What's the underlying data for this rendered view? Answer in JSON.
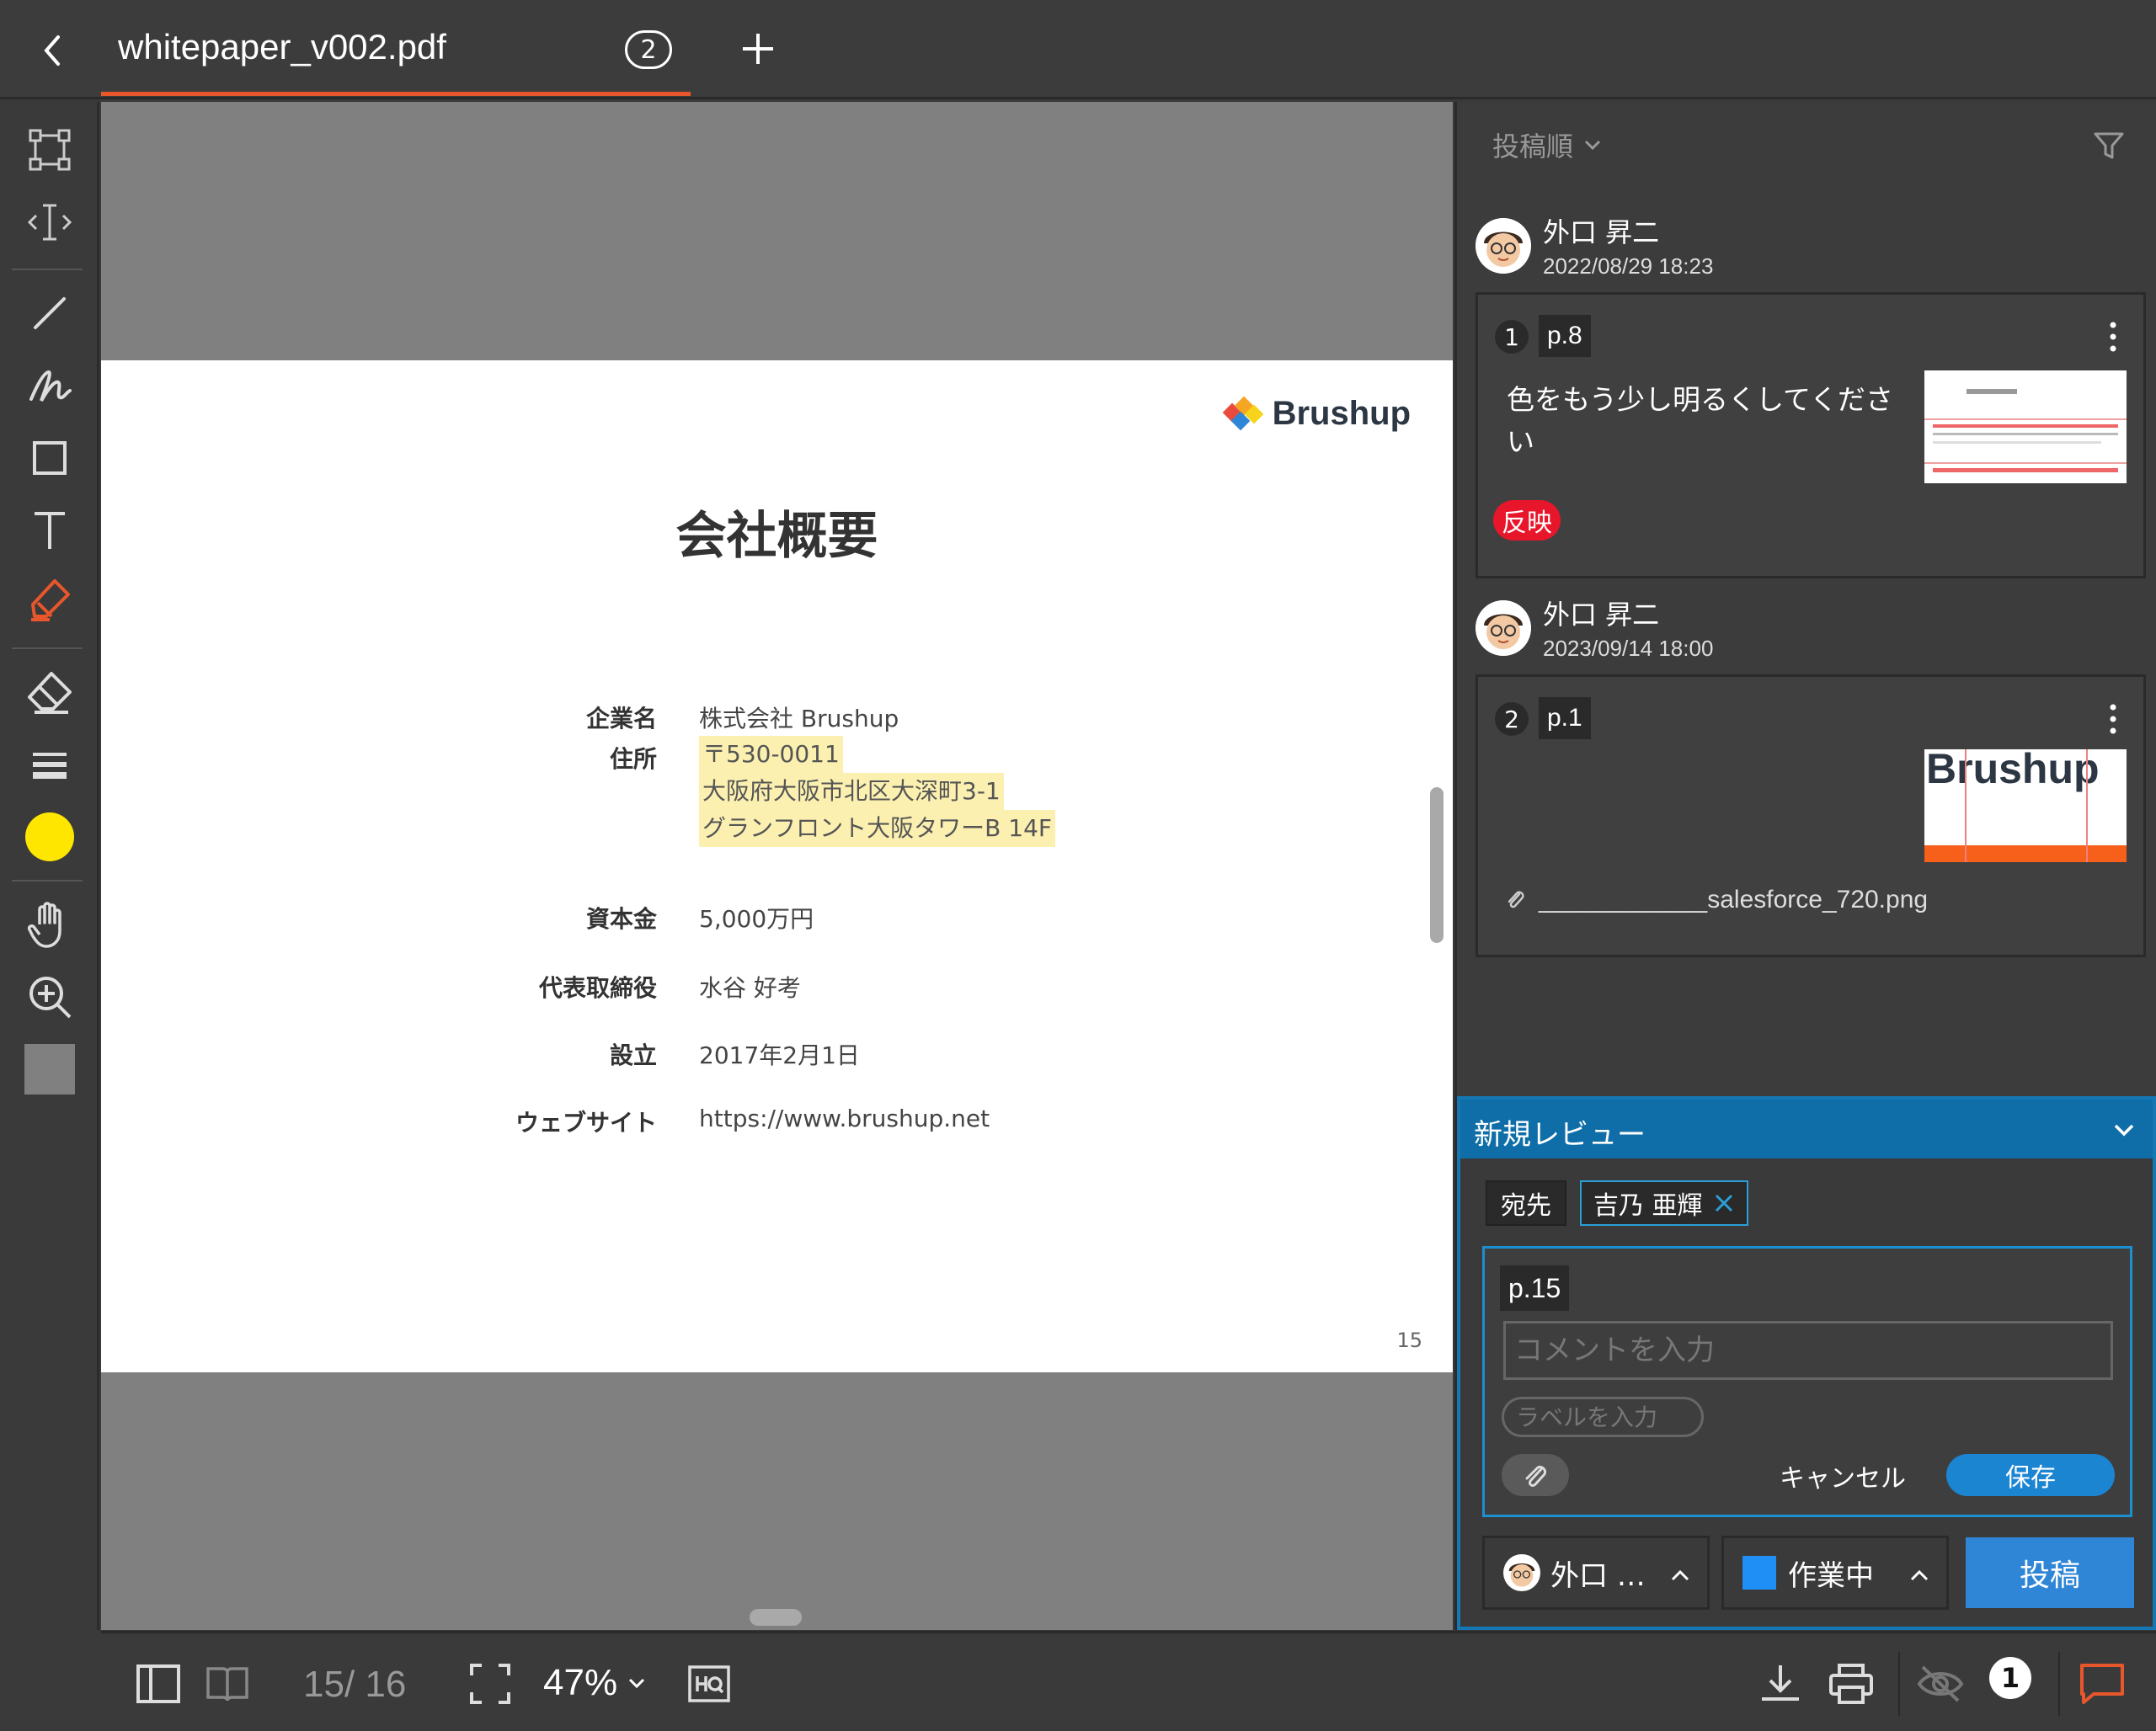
{
  "tab": {
    "title": "whitepaper_v002.pdf",
    "badge": "2"
  },
  "colors": {
    "accent": "#e8572c",
    "review_header": "#0f6ea8",
    "save": "#1c85d2",
    "post": "#2f86d6",
    "tag_red": "#e8162a",
    "highlight": "#fbf0b0",
    "current_color": "#ffe600",
    "status_color": "#1f8ef5"
  },
  "document": {
    "logo": "Brushup",
    "title": "会社概要",
    "rows": [
      {
        "label": "企業名",
        "value": "株式会社 Brushup"
      },
      {
        "label": "住所",
        "lines": [
          "〒530-0011",
          "大阪府大阪市北区大深町3-1",
          "グランフロント大阪タワーB 14F"
        ]
      },
      {
        "label": "資本金",
        "value": "5,000万円"
      },
      {
        "label": "代表取締役",
        "value": "水谷 好考"
      },
      {
        "label": "設立",
        "value": "2017年2月1日"
      },
      {
        "label": "ウェブサイト",
        "value": "https://www.brushup.net"
      }
    ],
    "page_number": "15"
  },
  "panel": {
    "sort_label": "投稿順",
    "comments": [
      {
        "author": "外口 昇二",
        "date": "2022/08/29 18:23",
        "number": "1",
        "page": "p.8",
        "text": "色をもう少し明るくしてください",
        "tag": "反映"
      },
      {
        "author": "外口 昇二",
        "date": "2023/09/14 18:00",
        "number": "2",
        "page": "p.1",
        "thumb_text": "Brushup",
        "attachment": "____________salesforce_720.png"
      }
    ]
  },
  "review": {
    "title": "新規レビュー",
    "to_label": "宛先",
    "recipient": "吉乃 亜輝",
    "page": "p.15",
    "comment_placeholder": "コメントを入力",
    "label_placeholder": "ラベルを入力",
    "cancel": "キャンセル",
    "save": "保存",
    "assignee": "外口 …",
    "status": "作業中",
    "post": "投稿"
  },
  "bottom": {
    "page_count": "15/ 16",
    "zoom": "47%",
    "notifications": "1"
  }
}
